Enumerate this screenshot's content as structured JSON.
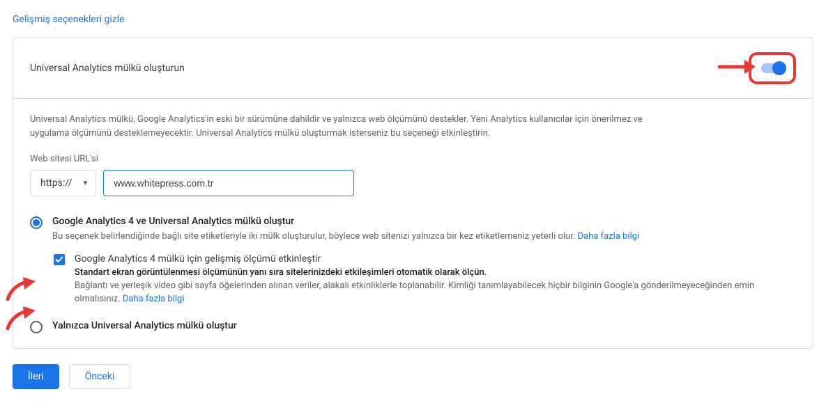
{
  "hide_link": "Gelişmiş seçenekleri gizle",
  "panel": {
    "title": "Universal Analytics mülkü oluşturun",
    "description": "Universal Analytics mülkü, Google Analytics'in eski bir sürümüne dahildir ve yalnızca web ölçümünü destekler. Yeni Analytics kullanıcılar için önerilmez ve uygulama ölçümünü desteklemeyecektir. Universal Analytics mülkü oluşturmak isterseniz bu seçeneği etkinleştirin.",
    "url_label": "Web sitesi URL'si",
    "protocol": "https://",
    "url_value": "www.whitepress.com.tr",
    "options": {
      "both": {
        "label": "Google Analytics 4 ve Universal Analytics mülkü oluştur",
        "sub": "Bu seçenek belirlendiğinde bağlı site etiketleriyle iki mülk oluşturulur, böylece web sitenizi yalnızca bir kez etiketlemeniz yeterli olur. ",
        "learn": "Daha fazla bilgi"
      },
      "enhanced": {
        "label": "Google Analytics 4 mülkü için gelişmiş ölçümü etkinleştir",
        "bold": "Standart ekran görüntülenmesi ölçümünün yanı sıra sitelerinizdeki etkileşimleri otomatik olarak ölçün.",
        "sub": "Bağlantı ve yerleşik video gibi sayfa öğelerinden alınan veriler, alakalı etkinliklerle toplanabilir. Kimliği tanımlayabilecek hiçbir bilginin Google'a gönderilmeyeceğinden emin olmalısınız. ",
        "learn": "Daha fazla bilgi"
      },
      "ua_only": {
        "label": "Yalnızca Universal Analytics mülkü oluştur"
      }
    }
  },
  "buttons": {
    "next": "İleri",
    "prev": "Önceki"
  }
}
